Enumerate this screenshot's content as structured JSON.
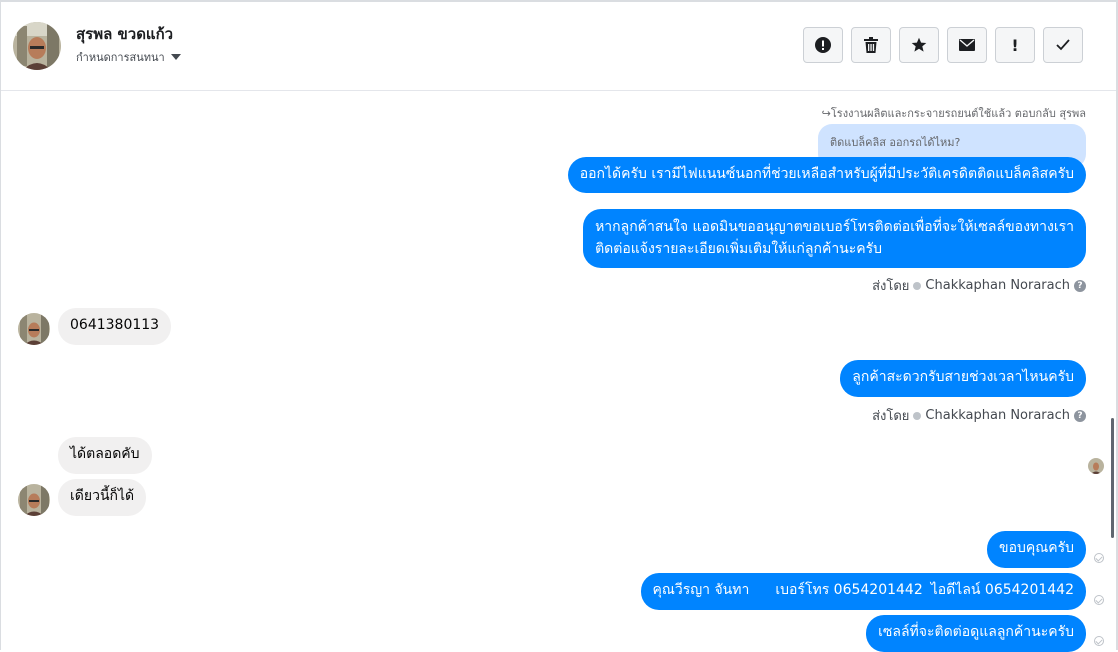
{
  "header": {
    "contact_name": "สุรพล ขวดแก้ว",
    "assign_label": "กำหนดการสนทนา",
    "actions": [
      {
        "name": "alert-icon",
        "glyph": "!"
      },
      {
        "name": "trash-icon",
        "glyph": ""
      },
      {
        "name": "star-icon",
        "glyph": "★"
      },
      {
        "name": "envelope-icon",
        "glyph": "✉"
      },
      {
        "name": "exclamation-icon",
        "glyph": "!"
      },
      {
        "name": "check-icon",
        "glyph": "✓"
      }
    ]
  },
  "messages": {
    "reply_note": "↪โรงงานผลิตและกระจายรถยนต์ใช้แล้ว ตอบกลับ สุรพล",
    "quoted_text": "ติดแบล็คลิส ออกรถได้ไหม?",
    "out_1": "ออกได้ครับ เรามีไฟแนนซ์นอกที่ช่วยเหลือสำหรับผู้ที่มีประวัติเครดิตติดแบล็คลิสครับ",
    "out_2_line1": "หากลูกค้าสนใจ แอดมินขออนุญาตขอเบอร์โทรติดต่อเพื่อที่จะให้เซลล์ของทางเรา",
    "out_2_line2": "ติดต่อแจ้งรายละเอียดเพิ่มเติมให้แก่ลูกค้านะครับ",
    "sent_by_label": "ส่งโดย",
    "sender_name": "Chakkaphan Norarach",
    "help_glyph": "?",
    "in_1": "0641380113",
    "out_3": "ลูกค้าสะดวกรับสายช่วงเวลาไหนครับ",
    "in_2": "ได้ตลอดคับ",
    "in_3": "เดียวนี้ก็ได้",
    "out_4": "ขอบคุณครับ",
    "out_5_name": "คุณวีรญา จันทา",
    "out_5_phone": "เบอร์โทร 0654201442",
    "out_5_line": "ไอดีไลน์ 0654201442",
    "out_6": "เซลล์ที่จะติดต่อดูแลลูกค้านะครับ"
  }
}
